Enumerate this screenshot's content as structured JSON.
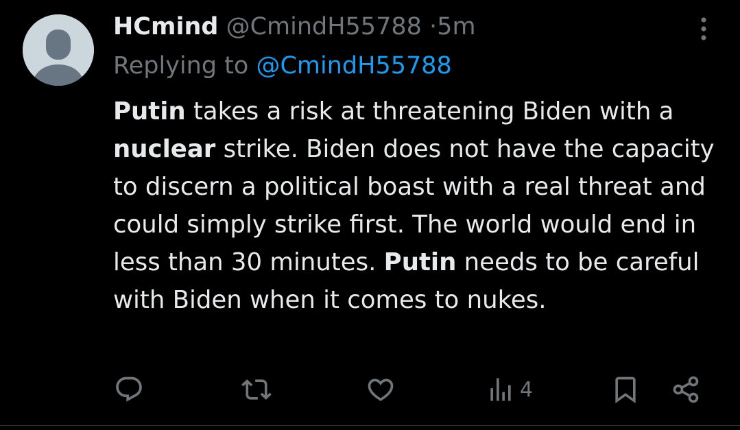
{
  "author": {
    "display_name": "HCmind",
    "handle": "@CmindH55788",
    "separator": "·",
    "time": "5m"
  },
  "reply": {
    "prefix": "Replying to",
    "mention": "@CmindH55788"
  },
  "body": {
    "seg1_bold": "Putin",
    "seg2": " takes a risk at threatening Biden with a ",
    "seg3_bold": "nuclear",
    "seg4": " strike. Biden does not have the capacity to discern a political boast with a real threat and could simply strike first. The world would end in less than 30 minutes. ",
    "seg5_bold": "Putin",
    "seg6": " needs to be careful with Biden when it comes to nukes."
  },
  "actions": {
    "reply_icon": "reply-icon",
    "retweet_icon": "retweet-icon",
    "like_icon": "heart-icon",
    "views_icon": "views-icon",
    "views_count": "4",
    "bookmark_icon": "bookmark-icon",
    "share_icon": "share-icon"
  },
  "colors": {
    "background": "#000000",
    "text": "#e7e9ea",
    "muted": "#71767b",
    "accent": "#1d9bf0",
    "avatar_bg": "#ccd6dd",
    "avatar_fg": "#687684"
  }
}
